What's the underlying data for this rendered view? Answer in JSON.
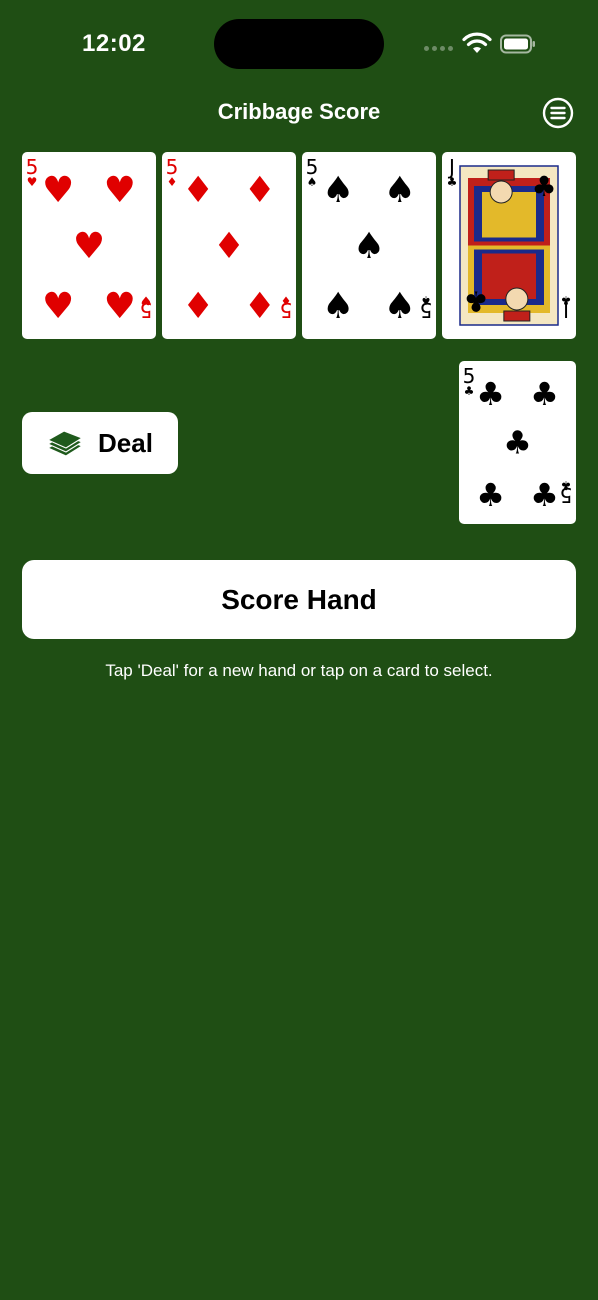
{
  "status_bar": {
    "time": "12:02"
  },
  "nav": {
    "title": "Cribbage Score",
    "menu_icon": "menu-circle-icon"
  },
  "hand": [
    {
      "rank": "5",
      "suit": "hearts",
      "symbol": "♥",
      "color": "#e00000"
    },
    {
      "rank": "5",
      "suit": "diamonds",
      "symbol": "♦",
      "color": "#e00000"
    },
    {
      "rank": "5",
      "suit": "spades",
      "symbol": "♠",
      "color": "#000000"
    },
    {
      "rank": "J",
      "suit": "clubs",
      "symbol": "♣",
      "color": "#000000"
    }
  ],
  "starter": {
    "rank": "5",
    "suit": "clubs",
    "symbol": "♣",
    "color": "#000000"
  },
  "deal_button": {
    "label": "Deal",
    "icon": "card-stack-icon"
  },
  "score_button": {
    "label": "Score Hand"
  },
  "instructions": "Tap 'Deal' for a new hand or tap on a card to select.",
  "colors": {
    "felt": "#1f4e14",
    "red_suit": "#e00000",
    "black_suit": "#000000"
  }
}
